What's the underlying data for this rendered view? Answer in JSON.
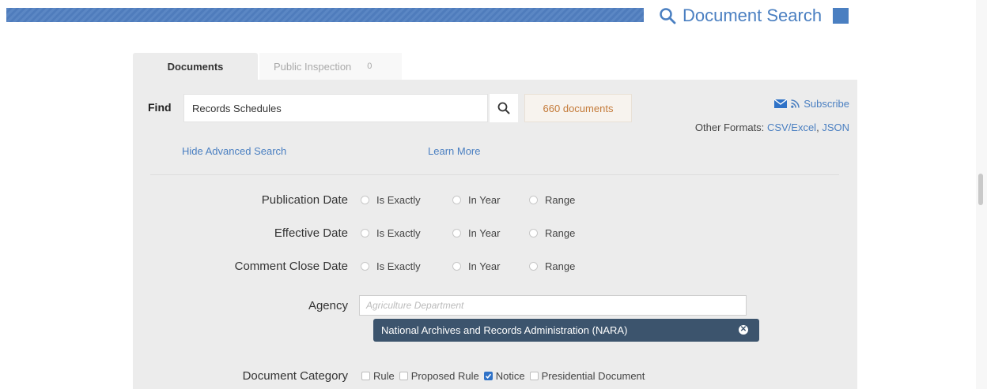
{
  "header": {
    "title": "Document Search",
    "colors": {
      "brand": "#4a7fc1",
      "bar": "#5b87c4"
    }
  },
  "tabs": [
    {
      "label": "Documents",
      "active": true
    },
    {
      "label": "Public Inspection",
      "count": "0",
      "active": false
    }
  ],
  "find": {
    "label": "Find",
    "value": "Records Schedules",
    "search_icon": "search-icon",
    "count_label": "660 documents"
  },
  "subscribe": {
    "label": "Subscribe",
    "icons": [
      "envelope-icon",
      "rss-icon"
    ]
  },
  "other_formats": {
    "label": "Other Formats:",
    "csv": "CSV/Excel",
    "sep": ",",
    "json": "JSON"
  },
  "links": {
    "hide_advanced": "Hide Advanced Search",
    "learn_more": "Learn More"
  },
  "date_fields": [
    {
      "label": "Publication Date",
      "options": [
        "Is Exactly",
        "In Year",
        "Range"
      ]
    },
    {
      "label": "Effective Date",
      "options": [
        "Is Exactly",
        "In Year",
        "Range"
      ]
    },
    {
      "label": "Comment Close Date",
      "options": [
        "Is Exactly",
        "In Year",
        "Range"
      ]
    }
  ],
  "agency": {
    "label": "Agency",
    "placeholder": "Agriculture Department",
    "selected": "National Archives and Records Administration (NARA)"
  },
  "document_category": {
    "label": "Document Category",
    "options": [
      {
        "label": "Rule",
        "checked": false
      },
      {
        "label": "Proposed Rule",
        "checked": false
      },
      {
        "label": "Notice",
        "checked": true
      },
      {
        "label": "Presidential Document",
        "checked": false
      }
    ]
  }
}
